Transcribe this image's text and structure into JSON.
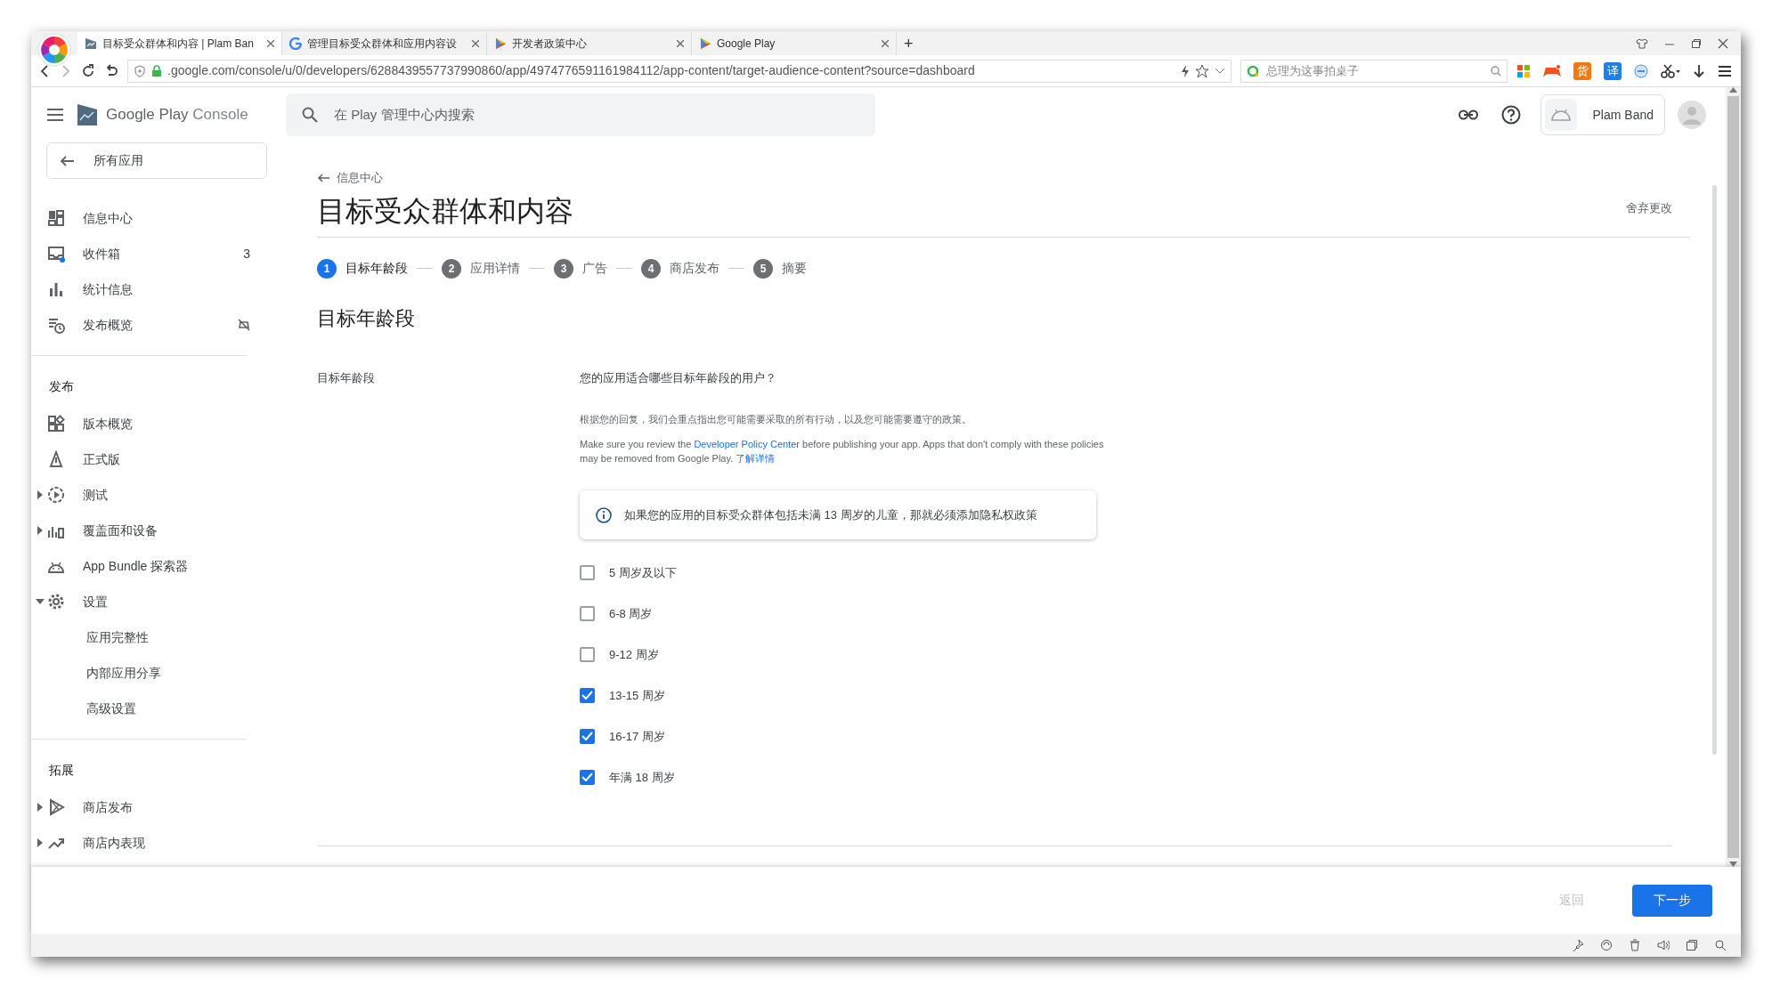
{
  "browser": {
    "tabs": [
      {
        "title": "目标受众群体和内容 | Plam Ban",
        "selected": true
      },
      {
        "title": "管理目标受众群体和应用内容设",
        "selected": false
      },
      {
        "title": "开发者政策中心",
        "selected": false
      },
      {
        "title": "Google Play",
        "selected": false
      }
    ],
    "new_tab": "+",
    "url": ".google.com/console/u/0/developers/6288439557737990860/app/4974776591161984112/app-content/target-audience-content?source=dashboard",
    "search_placeholder": "总理为这事拍桌子",
    "extensions": [
      {
        "kind": "grid"
      },
      {
        "kind": "game"
      },
      {
        "kind": "text",
        "label": "货",
        "color": "#f5780f"
      },
      {
        "kind": "text",
        "label": "译",
        "color": "#1e7fe8"
      },
      {
        "kind": "minus"
      },
      {
        "kind": "scissors"
      },
      {
        "kind": "download"
      },
      {
        "kind": "menu"
      }
    ]
  },
  "header": {
    "brand": "Google Play",
    "brand_suffix": "Console",
    "search_placeholder": "在 Play 管理中心内搜索",
    "account": "Plam Band"
  },
  "sidebar": {
    "back": "所有应用",
    "sections": [
      {
        "items": [
          {
            "label": "信息中心"
          },
          {
            "label": "收件箱",
            "count": "3"
          },
          {
            "label": "统计信息"
          },
          {
            "label": "发布概览",
            "muted": true
          }
        ]
      },
      {
        "heading": "发布",
        "items": [
          {
            "label": "版本概览"
          },
          {
            "label": "正式版"
          },
          {
            "label": "测试",
            "expanded": false
          },
          {
            "label": "覆盖面和设备",
            "expanded": false
          },
          {
            "label": "App Bundle 探索器"
          },
          {
            "label": "设置",
            "expanded": true,
            "children": [
              {
                "label": "应用完整性"
              },
              {
                "label": "内部应用分享"
              },
              {
                "label": "高级设置"
              }
            ]
          }
        ]
      },
      {
        "heading": "拓展",
        "items": [
          {
            "label": "商店发布",
            "expanded": false
          },
          {
            "label": "商店内表现",
            "expanded": false
          }
        ]
      }
    ]
  },
  "page": {
    "breadcrumb": "信息中心",
    "title": "目标受众群体和内容",
    "discard": "舍弃更改",
    "steps": [
      {
        "number": "1",
        "label": "目标年龄段",
        "selected": true
      },
      {
        "number": "2",
        "label": "应用详情",
        "selected": false
      },
      {
        "number": "3",
        "label": "广告",
        "selected": false
      },
      {
        "number": "4",
        "label": "商店发布",
        "selected": false
      },
      {
        "number": "5",
        "label": "摘要",
        "selected": false
      }
    ],
    "section_title": "目标年龄段",
    "field_label": "目标年龄段",
    "question": "您的应用适合哪些目标年龄段的用户？",
    "note": "根据您的回复，我们会重点指出您可能需要采取的所有行动，以及您可能需要遵守的政策。",
    "policy": {
      "before": "Make sure you review the ",
      "link": "Developer Policy Center",
      "after": " before publishing your app. Apps that don't comply with these policies may be removed from Google Play. ",
      "learn_more": "了解详情"
    },
    "info": "如果您的应用的目标受众群体包括未满 13 周岁的儿童，那就必须添加隐私权政策",
    "options": [
      {
        "label": "5 周岁及以下",
        "checked": false
      },
      {
        "label": "6-8 周岁",
        "checked": false
      },
      {
        "label": "9-12 周岁",
        "checked": false
      },
      {
        "label": "13-15 周岁",
        "checked": true
      },
      {
        "label": "16-17 周岁",
        "checked": true
      },
      {
        "label": "年满 18 周岁",
        "checked": true
      }
    ]
  },
  "footer": {
    "buttons": [
      {
        "label": "返回",
        "kind": "text",
        "disabled": true
      },
      {
        "label": "下一步",
        "kind": "primary",
        "disabled": false
      }
    ]
  }
}
